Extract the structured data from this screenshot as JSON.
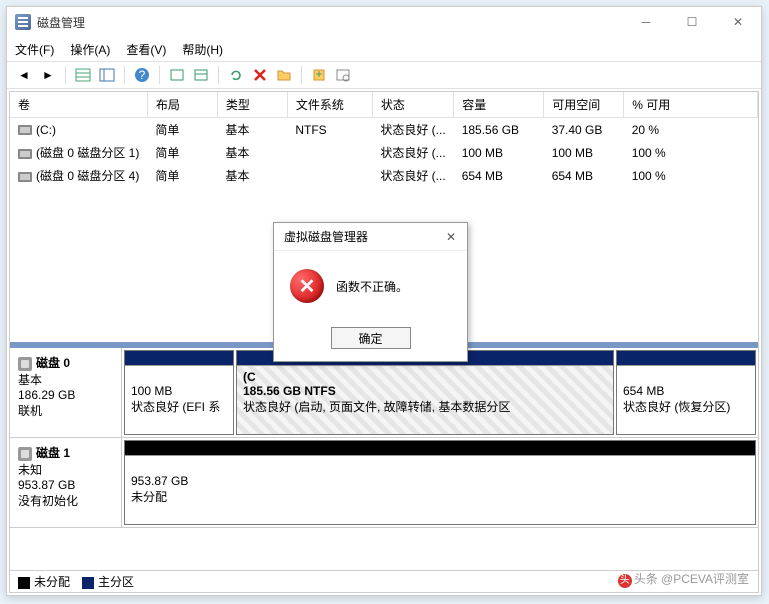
{
  "window": {
    "title": "磁盘管理"
  },
  "menu": {
    "file": "文件(F)",
    "action": "操作(A)",
    "view": "查看(V)",
    "help": "帮助(H)"
  },
  "table": {
    "headers": {
      "vol": "卷",
      "layout": "布局",
      "type": "类型",
      "fs": "文件系统",
      "status": "状态",
      "cap": "容量",
      "free": "可用空间",
      "pct": "% 可用"
    },
    "rows": [
      {
        "vol": "(C:)",
        "layout": "简单",
        "type": "基本",
        "fs": "NTFS",
        "status": "状态良好 (...",
        "cap": "185.56 GB",
        "free": "37.40 GB",
        "pct": "20 %"
      },
      {
        "vol": "(磁盘 0 磁盘分区 1)",
        "layout": "简单",
        "type": "基本",
        "fs": "",
        "status": "状态良好 (...",
        "cap": "100 MB",
        "free": "100 MB",
        "pct": "100 %"
      },
      {
        "vol": "(磁盘 0 磁盘分区 4)",
        "layout": "简单",
        "type": "基本",
        "fs": "",
        "status": "状态良好 (...",
        "cap": "654 MB",
        "free": "654 MB",
        "pct": "100 %"
      }
    ]
  },
  "disks": {
    "d0": {
      "name": "磁盘 0",
      "type": "基本",
      "size": "186.29 GB",
      "status": "联机",
      "p1": {
        "size": "100 MB",
        "status": "状态良好 (EFI 系"
      },
      "p2": {
        "label": "(C",
        "size": "185.56 GB NTFS",
        "status": "状态良好 (启动, 页面文件, 故障转储, 基本数据分区"
      },
      "p3": {
        "size": "654 MB",
        "status": "状态良好 (恢复分区)"
      }
    },
    "d1": {
      "name": "磁盘 1",
      "type": "未知",
      "size": "953.87 GB",
      "status": "没有初始化",
      "p1": {
        "size": "953.87 GB",
        "status": "未分配"
      }
    }
  },
  "legend": {
    "unalloc": "未分配",
    "primary": "主分区"
  },
  "dialog": {
    "title": "虚拟磁盘管理器",
    "message": "函数不正确。",
    "ok": "确定"
  },
  "watermark": "头条 @PCEVA评测室"
}
